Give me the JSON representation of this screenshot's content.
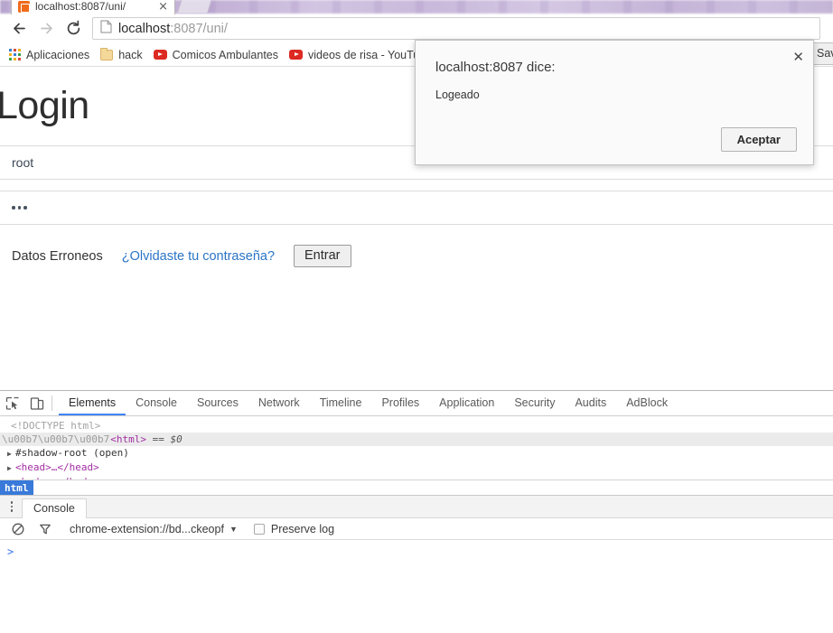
{
  "browser": {
    "tab": {
      "title": "localhost:8087/uni/",
      "close_label": "×",
      "favicon": "app-favicon"
    },
    "nav": {
      "back_icon": "back-arrow-icon",
      "forward_icon": "forward-arrow-icon",
      "reload_icon": "reload-icon"
    },
    "omnibox": {
      "page_icon": "document-icon",
      "url_host": "localhost",
      "url_path": ":8087/uni/"
    },
    "bookmarks": [
      {
        "label": "Aplicaciones",
        "icon": "apps-grid-icon"
      },
      {
        "label": "hack",
        "icon": "folder-icon"
      },
      {
        "label": "Comicos Ambulantes",
        "icon": "youtube-icon"
      },
      {
        "label": "videos de risa - YouTu",
        "icon": "youtube-icon"
      }
    ],
    "save_button_label": "Save"
  },
  "page": {
    "title": "Login",
    "username_value": "root",
    "password_masked": "•••",
    "error_text": "Datos Erroneos",
    "forgot_link": "¿Olvidaste tu contraseña?",
    "submit_label": "Entrar"
  },
  "dialog": {
    "title": "localhost:8087 dice:",
    "message": "Logeado",
    "ok_label": "Aceptar",
    "close_icon": "close-icon"
  },
  "devtools": {
    "inspect_icon": "inspect-element-icon",
    "device_icon": "device-toolbar-icon",
    "tabs": [
      {
        "label": "Elements",
        "active": true
      },
      {
        "label": "Console",
        "active": false
      },
      {
        "label": "Sources",
        "active": false
      },
      {
        "label": "Network",
        "active": false
      },
      {
        "label": "Timeline",
        "active": false
      },
      {
        "label": "Profiles",
        "active": false
      },
      {
        "label": "Application",
        "active": false
      },
      {
        "label": "Security",
        "active": false
      },
      {
        "label": "Audits",
        "active": false
      },
      {
        "label": "AdBlock",
        "active": false
      }
    ],
    "dom": {
      "doctype": "<!DOCTYPE html>",
      "html_open": "<html>",
      "html_selected_marker": "== $0",
      "shadow_root": "#shadow-root (open)",
      "head_line": "<head>…</head>",
      "body_line": "<body> </body>"
    },
    "breadcrumb": "html",
    "drawer": {
      "tab_label": "Console",
      "clear_icon": "clear-console-icon",
      "filter_icon": "filter-icon",
      "context": "chrome-extension://bd...ckeopf",
      "context_caret": "▼",
      "preserve_log_label": "Preserve log",
      "prompt": ">"
    }
  },
  "colors": {
    "accent_blue": "#4285f4",
    "link_blue": "#2a74c6",
    "breadcrumb_blue": "#3879d9",
    "tag_purple": "#a22ea2",
    "youtube_red": "#dc2a22",
    "favicon_orange": "#ef6c1a"
  }
}
